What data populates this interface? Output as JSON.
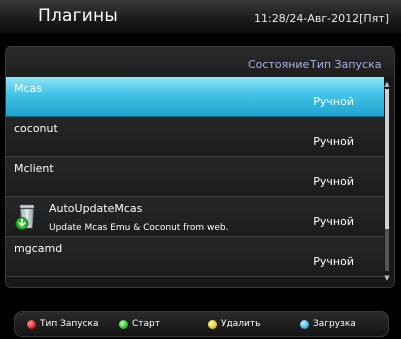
{
  "header": {
    "title": "Плагины",
    "datetime": "11:28/24-Авг-2012[Пят]"
  },
  "columns": {
    "state": "Состояние",
    "launch_type": "Тип Запуска"
  },
  "plugins": [
    {
      "name": "Mcas",
      "description": "",
      "mode": "Ручной",
      "selected": true,
      "icon": ""
    },
    {
      "name": "coconut",
      "description": "",
      "mode": "Ручной",
      "selected": false,
      "icon": ""
    },
    {
      "name": "Mclient",
      "description": "",
      "mode": "Ручной",
      "selected": false,
      "icon": ""
    },
    {
      "name": "AutoUpdateMcas",
      "description": "Update Mcas Emu & Coconut from web.",
      "mode": "Ручной",
      "selected": false,
      "icon": "trash-download-icon"
    },
    {
      "name": "mgcamd",
      "description": "",
      "mode": "Ручной",
      "selected": false,
      "icon": ""
    }
  ],
  "scroll": {
    "position": 0,
    "visible_fraction": 0.77
  },
  "footer": {
    "red": "Тип Запуска",
    "green": "Старт",
    "yellow": "Удалить",
    "blue": "Загрузка"
  },
  "colors": {
    "selected_row": "#42c2e6",
    "column_header_text": "#aab0e8",
    "red_key": "#d01515",
    "green_key": "#23b31f",
    "yellow_key": "#d8c21a",
    "blue_key": "#2ea8d8"
  }
}
